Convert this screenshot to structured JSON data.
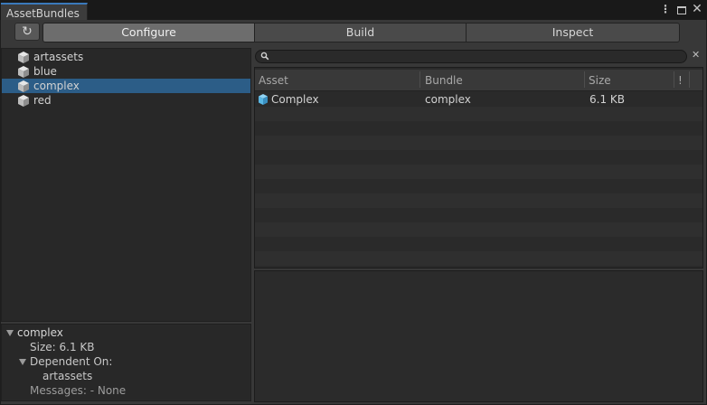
{
  "window": {
    "tab_title": "AssetBundles"
  },
  "toolbar": {
    "modes": [
      "Configure",
      "Build",
      "Inspect"
    ],
    "active_mode": "Configure"
  },
  "bundles": [
    {
      "name": "artassets"
    },
    {
      "name": "blue"
    },
    {
      "name": "complex",
      "selected": true
    },
    {
      "name": "red"
    }
  ],
  "details": {
    "bundle_name": "complex",
    "size_line": "Size: 6.1 KB",
    "dependent_label": "Dependent On:",
    "dependent_items": [
      "artassets"
    ],
    "messages_line": "Messages: - None"
  },
  "search": {
    "value": "",
    "placeholder": ""
  },
  "asset_table": {
    "columns": [
      "Asset",
      "Bundle",
      "Size",
      "!"
    ],
    "rows": [
      {
        "asset": "Complex",
        "bundle": "complex",
        "size": "6.1 KB"
      }
    ]
  },
  "colors": {
    "selection": "#2c5d87",
    "active_mode_bg": "#6d6d6d",
    "tab_accent": "#3a79bb",
    "cube_icon": "#d6d6d6",
    "asset_icon": "#59b8e6"
  },
  "icons": {
    "refresh": "refresh-icon",
    "bundle": "cube-icon",
    "asset": "prefab-cube-icon",
    "search": "search-icon",
    "clear": "close-icon"
  }
}
